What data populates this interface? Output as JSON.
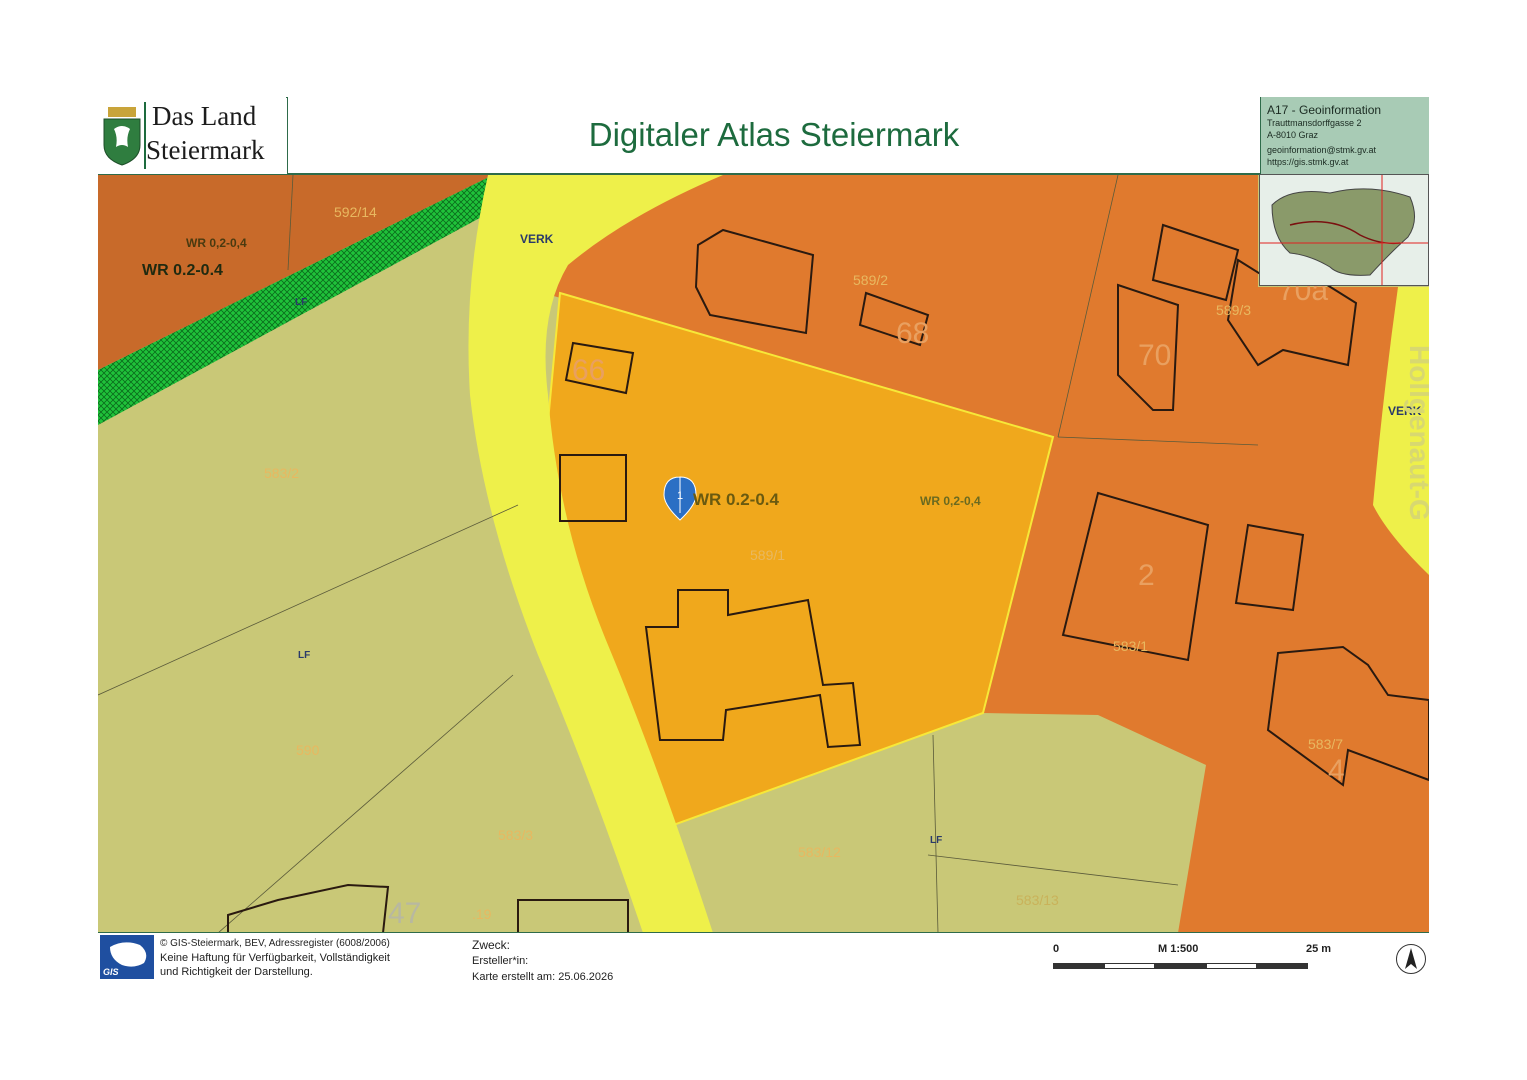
{
  "header": {
    "logo_line1": "Das Land",
    "logo_line2": "Steiermark",
    "title": "Digitaler Atlas Steiermark"
  },
  "contact": {
    "org": "A17 - Geoinformation",
    "street": "Trauttmansdorffgasse 2",
    "city": "A-8010 Graz",
    "email": "geoinformation@stmk.gv.at",
    "web": "https://gis.stmk.gv.at"
  },
  "map": {
    "zones": {
      "wr_top_left_small": "WR 0,2-0,4",
      "wr_top_left_big": "WR 0.2-0.4",
      "wr_center_big": "WR 0.2-0.4",
      "wr_center_small": "WR 0,2-0,4",
      "verk_top": "VERK",
      "verk_right": "VERK",
      "lf_top": "LF",
      "lf_left": "LF",
      "lf_bottom": "LF"
    },
    "parcels": [
      "592/14",
      "583/2",
      "589/1",
      "589/2",
      "589/3",
      "590",
      "583/3",
      "583/12",
      "583/13",
      "583/7",
      "583/1",
      ".19"
    ],
    "house_numbers": [
      "66",
      "68",
      "70",
      "2",
      "47",
      "4",
      "70a"
    ],
    "marker_number": "1",
    "street_name_fragment": "Hollgenaut-G"
  },
  "footer": {
    "gis_label": "GIS",
    "credit_line1": "© GIS-Steiermark, BEV, Adressregister (6008/2006)",
    "credit_line2": "Keine Haftung für Verfügbarkeit, Vollständigkeit",
    "credit_line3": "und Richtigkeit der Darstellung.",
    "purpose_label": "Zweck:",
    "author_label": "Ersteller*in:",
    "created_label": "Karte erstellt am: 25.06.2026",
    "scale_zero": "0",
    "scale_ratio": "M 1:500",
    "scale_end": "25 m"
  },
  "colors": {
    "zone_orange": "#e07a2e",
    "zone_selected": "#f0a81c",
    "road_yellow": "#eef04a",
    "green_belt": "#1fc23a",
    "agri_land": "#c9c877",
    "title_green": "#1d6b3e",
    "marker_blue": "#2b6fc4"
  }
}
